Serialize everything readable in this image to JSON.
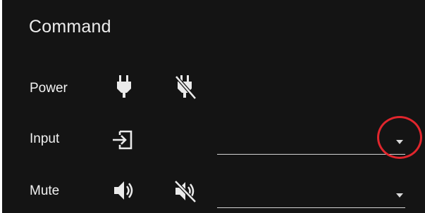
{
  "panel": {
    "title": "Command"
  },
  "rows": {
    "power": {
      "label": "Power",
      "icons": [
        "power-plug-icon",
        "power-plug-off-icon"
      ]
    },
    "input": {
      "label": "Input",
      "icons": [
        "input-icon"
      ],
      "select_value": ""
    },
    "mute": {
      "label": "Mute",
      "icons": [
        "volume-on-icon",
        "volume-off-icon"
      ],
      "select_value": ""
    }
  },
  "annotation": {
    "highlight_color": "#e0262d",
    "highlighted": "input-dropdown-arrow"
  },
  "colors": {
    "background": "#141414",
    "text": "#ececec",
    "underline": "#d4d4d4"
  }
}
